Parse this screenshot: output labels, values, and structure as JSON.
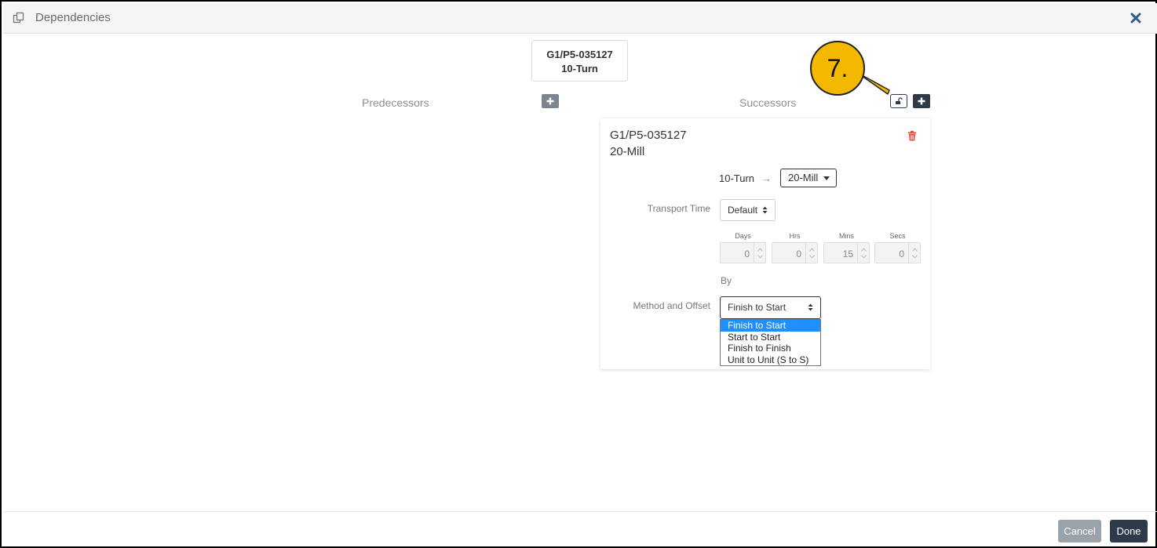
{
  "header": {
    "title": "Dependencies",
    "dep_icon": "copy-icon",
    "close_icon": "close-icon"
  },
  "node": {
    "id": "G1/P5-035127",
    "op": "10-Turn"
  },
  "columns": {
    "predecessors_label": "Predecessors",
    "successors_label": "Successors"
  },
  "callout": {
    "label": "7."
  },
  "successor": {
    "id": "G1/P5-035127",
    "op": "20-Mill",
    "from_op": "10-Turn",
    "arrow": "→",
    "to_op_selected": "20-Mill",
    "transport_time_label": "Transport Time",
    "transport_time_selected": "Default",
    "time": {
      "days": {
        "label": "Days",
        "value": "0"
      },
      "hrs": {
        "label": "Hrs",
        "value": "0"
      },
      "mins": {
        "label": "Mins",
        "value": "15"
      },
      "secs": {
        "label": "Secs",
        "value": "0"
      }
    },
    "by_label": "By",
    "method_label": "Method and Offset",
    "method_selected": "Finish to Start",
    "method_options": [
      "Finish to Start",
      "Start to Start",
      "Finish to Finish",
      "Unit to Unit (S to S)"
    ]
  },
  "footer": {
    "cancel_label": "Cancel",
    "done_label": "Done"
  },
  "colors": {
    "primary_dark": "#2d3a4a",
    "callout": "#f5b800",
    "danger": "#e74c3c",
    "selection": "#1e90ff"
  }
}
